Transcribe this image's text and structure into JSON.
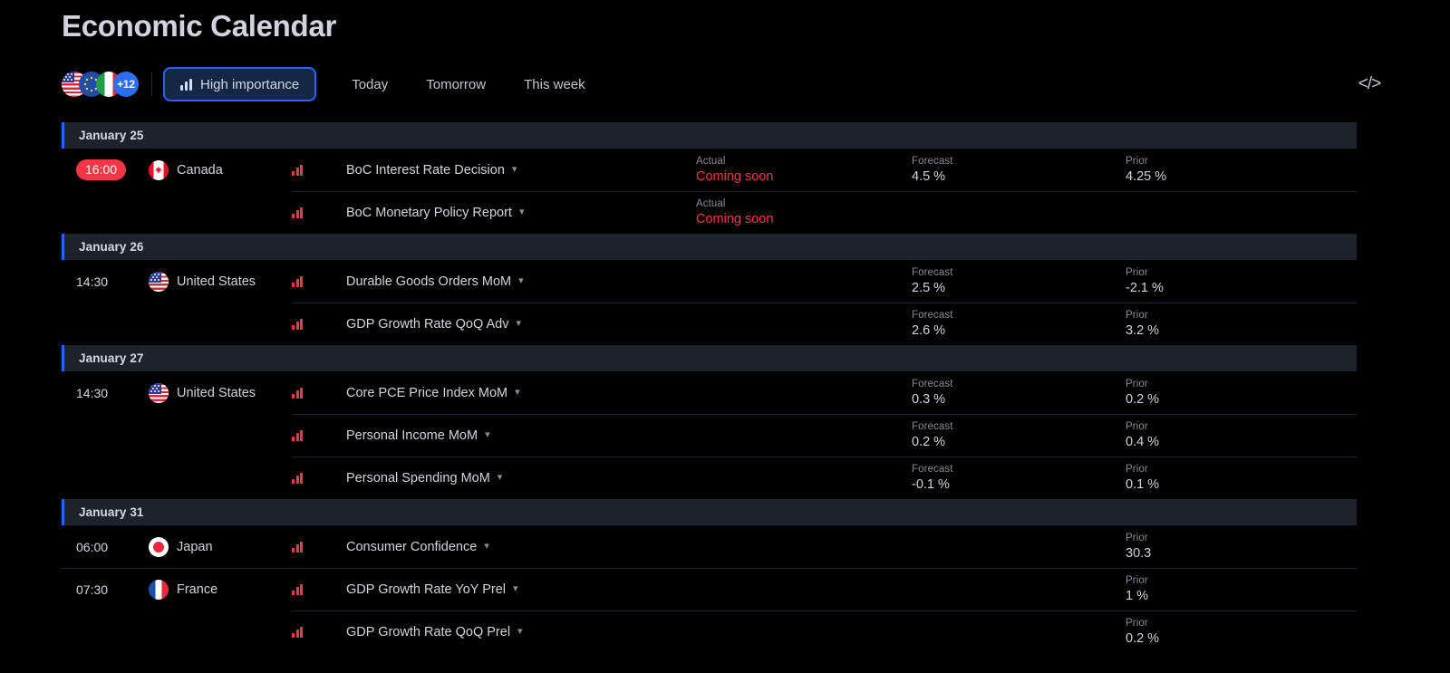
{
  "header": {
    "title": "Economic Calendar"
  },
  "toolbar": {
    "country_filter": {
      "flags": [
        "united-states",
        "european-union",
        "italy"
      ],
      "more_label": "+12"
    },
    "importance_button": {
      "label": "High importance",
      "icon": "bar-chart-icon",
      "active": true,
      "border_color": "#2962ff",
      "background_color": "#142744"
    },
    "tabs": [
      {
        "label": "Today",
        "active": false
      },
      {
        "label": "Tomorrow",
        "active": false
      },
      {
        "label": "This week",
        "active": false
      }
    ],
    "embed_button": {
      "label": "</>",
      "icon": "code-icon"
    }
  },
  "columns": {
    "actual": "Actual",
    "forecast": "Forecast",
    "prior": "Prior"
  },
  "accent_colors": {
    "date_marker": "#2962ff",
    "importance": "#f23645",
    "pending": "#f23645",
    "time_badge": "#f23645"
  },
  "groups": [
    {
      "date": "January 25",
      "rows": [
        {
          "time": "16:00",
          "time_highlighted": true,
          "country": "Canada",
          "flag": "canada",
          "importance": "high",
          "event": "BoC Interest Rate Decision",
          "actual_label": "Actual",
          "actual": "Coming soon",
          "actual_pending": true,
          "forecast_label": "Forecast",
          "forecast": "4.5 %",
          "prior_label": "Prior",
          "prior": "4.25 %",
          "divider": "none"
        },
        {
          "time": "",
          "time_highlighted": false,
          "country": "",
          "flag": "",
          "importance": "high",
          "event": "BoC Monetary Policy Report",
          "actual_label": "Actual",
          "actual": "Coming soon",
          "actual_pending": true,
          "forecast_label": "",
          "forecast": "",
          "prior_label": "",
          "prior": "",
          "divider": "event"
        }
      ]
    },
    {
      "date": "January 26",
      "rows": [
        {
          "time": "14:30",
          "time_highlighted": false,
          "country": "United States",
          "flag": "united-states",
          "importance": "high",
          "event": "Durable Goods Orders MoM",
          "actual_label": "",
          "actual": "",
          "actual_pending": false,
          "forecast_label": "Forecast",
          "forecast": "2.5 %",
          "prior_label": "Prior",
          "prior": "-2.1 %",
          "divider": "none"
        },
        {
          "time": "",
          "time_highlighted": false,
          "country": "",
          "flag": "",
          "importance": "high",
          "event": "GDP Growth Rate QoQ Adv",
          "actual_label": "",
          "actual": "",
          "actual_pending": false,
          "forecast_label": "Forecast",
          "forecast": "2.6 %",
          "prior_label": "Prior",
          "prior": "3.2 %",
          "divider": "event"
        }
      ]
    },
    {
      "date": "January 27",
      "rows": [
        {
          "time": "14:30",
          "time_highlighted": false,
          "country": "United States",
          "flag": "united-states",
          "importance": "high",
          "event": "Core PCE Price Index MoM",
          "actual_label": "",
          "actual": "",
          "actual_pending": false,
          "forecast_label": "Forecast",
          "forecast": "0.3 %",
          "prior_label": "Prior",
          "prior": "0.2 %",
          "divider": "none"
        },
        {
          "time": "",
          "time_highlighted": false,
          "country": "",
          "flag": "",
          "importance": "high",
          "event": "Personal Income MoM",
          "actual_label": "",
          "actual": "",
          "actual_pending": false,
          "forecast_label": "Forecast",
          "forecast": "0.2 %",
          "prior_label": "Prior",
          "prior": "0.4 %",
          "divider": "event"
        },
        {
          "time": "",
          "time_highlighted": false,
          "country": "",
          "flag": "",
          "importance": "high",
          "event": "Personal Spending MoM",
          "actual_label": "",
          "actual": "",
          "actual_pending": false,
          "forecast_label": "Forecast",
          "forecast": "-0.1 %",
          "prior_label": "Prior",
          "prior": "0.1 %",
          "divider": "event"
        }
      ]
    },
    {
      "date": "January 31",
      "rows": [
        {
          "time": "06:00",
          "time_highlighted": false,
          "country": "Japan",
          "flag": "japan",
          "importance": "high",
          "event": "Consumer Confidence",
          "actual_label": "",
          "actual": "",
          "actual_pending": false,
          "forecast_label": "",
          "forecast": "",
          "prior_label": "Prior",
          "prior": "30.3",
          "divider": "none"
        },
        {
          "time": "07:30",
          "time_highlighted": false,
          "country": "France",
          "flag": "france",
          "importance": "high",
          "event": "GDP Growth Rate YoY Prel",
          "actual_label": "",
          "actual": "",
          "actual_pending": false,
          "forecast_label": "",
          "forecast": "",
          "prior_label": "Prior",
          "prior": "1 %",
          "divider": "full"
        },
        {
          "time": "",
          "time_highlighted": false,
          "country": "",
          "flag": "",
          "importance": "high",
          "event": "GDP Growth Rate QoQ Prel",
          "actual_label": "",
          "actual": "",
          "actual_pending": false,
          "forecast_label": "",
          "forecast": "",
          "prior_label": "Prior",
          "prior": "0.2 %",
          "divider": "event"
        }
      ]
    }
  ]
}
